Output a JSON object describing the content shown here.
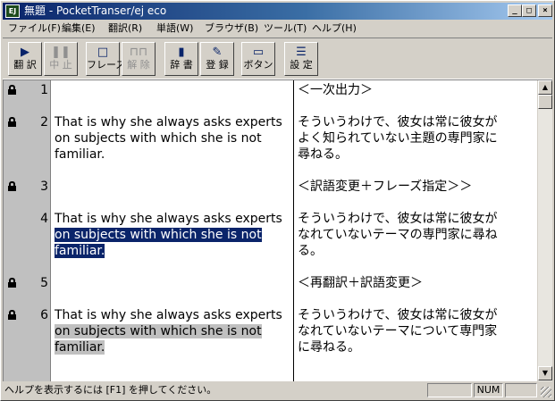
{
  "window": {
    "title": "無題 - PocketTranser/ej eco",
    "app_icon_text": "EJ",
    "minimize": "_",
    "maximize": "□",
    "close": "×"
  },
  "menu": [
    "ファイル(F)",
    "編集(E)",
    "翻訳(R)",
    "単語(W)",
    "ブラウザ(B)",
    "ツール(T)",
    "ヘルプ(H)"
  ],
  "toolbar": {
    "translate": "翻 訳",
    "stop": "中 止",
    "phrase": "フレーズ",
    "release": "解 除",
    "dictionary": "辞 書",
    "register": "登 録",
    "button": "ボタン",
    "settings": "設 定"
  },
  "rows": [
    {
      "num": "1",
      "source_lines": [],
      "target_lines": [
        "＜一次出力＞"
      ]
    },
    {
      "num": "2",
      "source_lines": [
        "That is why she always asks experts",
        "on subjects with which she is not",
        "familiar."
      ],
      "target_lines": [
        "そういうわけで、彼女は常に彼女が",
        "よく知られていない主題の専門家に",
        "尋ねる。"
      ]
    },
    {
      "num": "3",
      "source_lines": [],
      "target_lines": [
        "＜訳語変更＋フレーズ指定＞＞"
      ]
    },
    {
      "num": "4",
      "source_lines": [
        "That is why she always asks experts",
        "on subjects with which she is not",
        "familiar."
      ],
      "target_lines": [
        "そういうわけで、彼女は常に彼女が",
        "なれていないテーマの専門家に尋ね",
        "る。"
      ]
    },
    {
      "num": "5",
      "source_lines": [],
      "target_lines": [
        "＜再翻訳＋訳語変更＞"
      ]
    },
    {
      "num": "6",
      "source_lines": [
        "That is why she always asks experts",
        "on subjects with which she is not",
        "familiar."
      ],
      "target_lines": [
        "そういうわけで、彼女は常に彼女が",
        "なれていないテーマについて専門家",
        "に尋ねる。"
      ]
    }
  ],
  "status": {
    "help_text": "ヘルプを表示するには [F1] を押してください。",
    "num": "NUM"
  },
  "colors": {
    "selection": "#0a246a",
    "gray_highlight": "#c0c0c0",
    "titlebar_start": "#0a246a"
  }
}
